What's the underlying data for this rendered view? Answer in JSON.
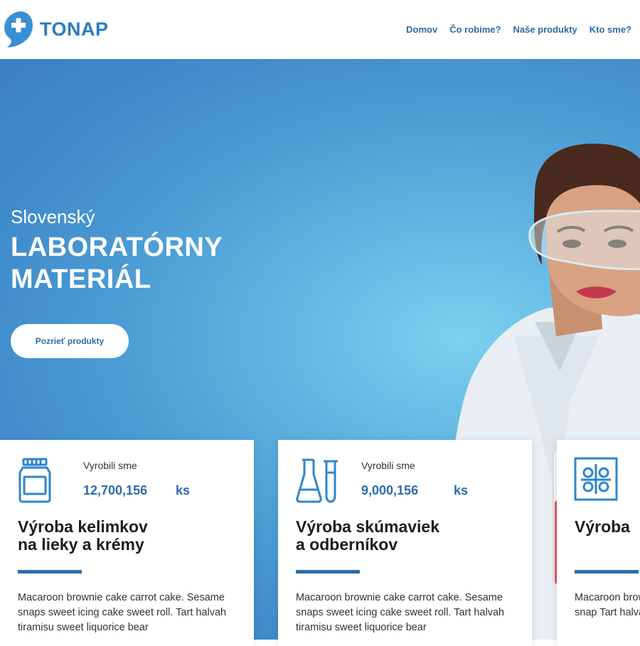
{
  "brand": {
    "name": "TONAP"
  },
  "nav": [
    {
      "label": "Domov"
    },
    {
      "label": "Čo robíme?"
    },
    {
      "label": "Naše produkty"
    },
    {
      "label": "Kto sme?"
    }
  ],
  "hero": {
    "subtitle": "Slovenský",
    "title_line1": "LABORATÓRNY",
    "title_line2": "MATERIÁL",
    "button": "Pozrieť produkty"
  },
  "cards": [
    {
      "icon": "jar-icon",
      "stat_label": "Vyrobili sme",
      "stat_value": "12,700,156",
      "stat_unit": "ks",
      "title_line1": "Výroba kelimkov",
      "title_line2": "na lieky a krémy",
      "text": "Macaroon brownie cake carrot cake. Sesame snaps sweet icing cake sweet roll. Tart halvah tiramisu sweet liquorice bear"
    },
    {
      "icon": "flask-and-test-tube-icon",
      "stat_label": "Vyrobili sme",
      "stat_value": "9,000,156",
      "stat_unit": "ks",
      "title_line1": "Výroba skúmaviek",
      "title_line2": "a odberníkov",
      "text": "Macaroon brownie cake carrot cake. Sesame snaps sweet icing cake sweet roll. Tart halvah tiramisu sweet liquorice bear"
    },
    {
      "icon": "well-plate-icon",
      "title_line1": "Výroba",
      "text": "Macaroon brownie cake carrot cake. Sesame snap Tart halvah tir"
    }
  ],
  "colors": {
    "accent": "#2d6ca7",
    "brand": "#2d7bc0",
    "hero_top": "#3e88c9",
    "hero_glow": "#7dd0ee"
  }
}
